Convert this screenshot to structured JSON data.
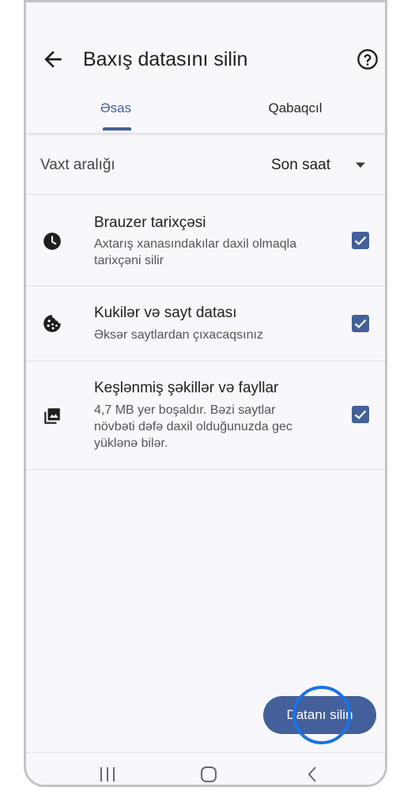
{
  "header": {
    "title": "Baxış datasını silin",
    "back_icon": "arrow-left-icon",
    "help_icon": "help-circle-icon"
  },
  "tabs": [
    {
      "label": "Əsas",
      "active": true
    },
    {
      "label": "Qabaqcıl",
      "active": false
    }
  ],
  "time_range": {
    "label": "Vaxt aralığı",
    "value": "Son saat"
  },
  "items": [
    {
      "icon": "clock-icon",
      "title": "Brauzer tarixçəsi",
      "desc_lines": [
        "Axtarış xanasındakılar daxil olmaqla",
        "tarixçəni silir"
      ],
      "checked": true
    },
    {
      "icon": "cookie-icon",
      "title": "Kukilər və sayt datası",
      "desc_lines": [
        "Əksər saytlardan çıxacaqsınız"
      ],
      "checked": true
    },
    {
      "icon": "image-icon",
      "title": "Keşlənmiş şəkillər və fayllar",
      "desc_lines": [
        "4,7 MB yer boşaldır. Bəzi saytlar",
        "növbəti dəfə daxil olduğunuzda gec",
        "yüklənə bilər."
      ],
      "checked": true
    }
  ],
  "delete_button": {
    "label": "Datanı silin"
  },
  "colors": {
    "accent": "#44609a",
    "highlight": "#1a73e8",
    "background": "#f8f8fc"
  },
  "navbar": {
    "recents_icon": "recents-icon",
    "home_icon": "home-icon",
    "back_icon": "nav-back-icon"
  }
}
